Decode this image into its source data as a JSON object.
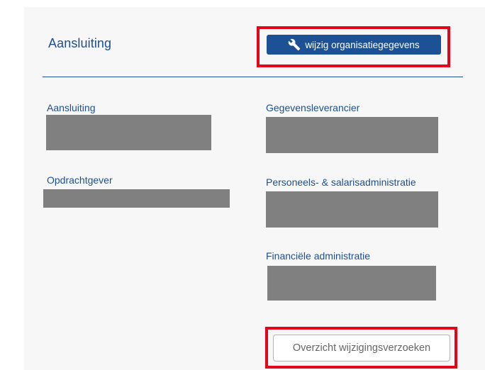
{
  "section": {
    "title": "Aansluiting",
    "edit_button_label": "wijzig organisatiegegevens",
    "edit_button_icon": "wrench-icon"
  },
  "fields": {
    "aansluiting": {
      "label": "Aansluiting"
    },
    "opdrachtgever": {
      "label": "Opdrachtgever"
    },
    "gegevensleverancier": {
      "label": "Gegevensleverancier"
    },
    "personeels_salaris": {
      "label": "Personeels- & salarisadministratie"
    },
    "financiele": {
      "label": "Financiële administratie"
    }
  },
  "overview_button_label": "Overzicht wijzigingsverzoeken",
  "colors": {
    "accent": "#1d4f91",
    "button_bg": "#1d5196",
    "highlight": "#e3061a",
    "redaction": "#808080"
  }
}
